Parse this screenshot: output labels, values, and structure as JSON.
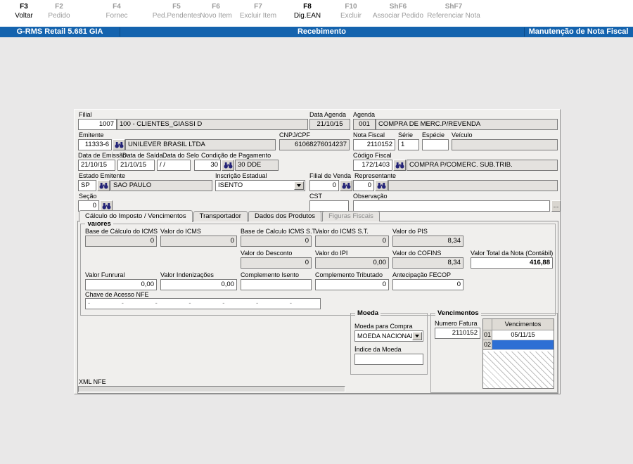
{
  "colors": {
    "titlebar_blue": "#1463ae",
    "selection_blue": "#2e6fd4"
  },
  "fkeys": [
    {
      "key": "F3",
      "label": "Voltar",
      "active": true
    },
    {
      "key": "F2",
      "label": "Pedido",
      "active": false
    },
    {
      "key": "F4",
      "label": "Fornec",
      "active": false
    },
    {
      "key": "F5",
      "label": "Ped.Pendentes",
      "active": false
    },
    {
      "key": "F6",
      "label": "Novo Item",
      "active": false
    },
    {
      "key": "F7",
      "label": "Excluir Item",
      "active": false
    },
    {
      "key": "F8",
      "label": "Dig.EAN",
      "active": true
    },
    {
      "key": "F10",
      "label": "Excluir",
      "active": false
    },
    {
      "key": "ShF6",
      "label": "Associar Pedido",
      "active": false
    },
    {
      "key": "ShF7",
      "label": "Referenciar Nota",
      "active": false
    }
  ],
  "titlebar": {
    "app": "G-RMS Retail 5.681 GIA",
    "screen": "Recebimento",
    "window": "Manutenção de Nota Fiscal"
  },
  "form": {
    "filial": {
      "label": "Filial",
      "code": "1007",
      "name": "100 - CLIENTES_GIASSI D"
    },
    "data_agenda": {
      "label": "Data Agenda",
      "value": "21/10/15"
    },
    "agenda": {
      "label": "Agenda",
      "code": "001",
      "name": "COMPRA DE MERC.P/REVENDA"
    },
    "emitente": {
      "label": "Emitente",
      "code": "11333-6",
      "name": "UNILEVER BRASIL LTDA"
    },
    "cnpj": {
      "label": "CNPJ/CPF",
      "value": "61068276014237"
    },
    "nota_fiscal": {
      "label": "Nota Fiscal",
      "value": "2110152"
    },
    "serie": {
      "label": "Série",
      "value": "1"
    },
    "especie": {
      "label": "Espécie",
      "value": ""
    },
    "veiculo": {
      "label": "Veículo",
      "value": ""
    },
    "data_emissao": {
      "label": "Data de Emissão",
      "value": "21/10/15"
    },
    "data_saida": {
      "label": "Data de Saída",
      "value": "21/10/15"
    },
    "data_selo": {
      "label": "Data do Selo",
      "value": "/ /"
    },
    "cond_pagamento": {
      "label": "Condição de Pagamento",
      "code": "30",
      "name": "30 DDE"
    },
    "codigo_fiscal": {
      "label": "Código Fiscal",
      "code": "172/1403",
      "name": "COMPRA P/COMERC. SUB.TRIB."
    },
    "estado": {
      "label": "Estado Emitente",
      "code": "SP",
      "name": "SAO PAULO"
    },
    "inscricao": {
      "label": "Inscrição Estadual",
      "value": "ISENTO"
    },
    "filial_venda": {
      "label": "Filial de Venda",
      "value": "0"
    },
    "representante": {
      "label": "Representante",
      "code": "0",
      "name": ""
    },
    "secao": {
      "label": "Seção",
      "value": "0"
    },
    "cst": {
      "label": "CST",
      "value": ""
    },
    "observacao": {
      "label": "Observação",
      "value": "",
      "button": "..."
    }
  },
  "tabs": [
    {
      "label": "Cálculo do Imposto / Vencimentos",
      "active": true
    },
    {
      "label": "Transportador",
      "active": false
    },
    {
      "label": "Dados dos Produtos",
      "active": false
    },
    {
      "label": "Figuras Fiscais",
      "active": false,
      "disabled": true
    }
  ],
  "valores": {
    "title": "Valores",
    "row1": [
      {
        "label": "Base de Cálculo do ICMS",
        "value": "0"
      },
      {
        "label": "Valor do ICMS",
        "value": "0"
      },
      {
        "label": "Base de Calculo ICMS S.T.",
        "value": "0"
      },
      {
        "label": "Valor do ICMS S.T.",
        "value": "0"
      },
      {
        "label": "Valor do PIS",
        "value": "8,34"
      }
    ],
    "row2": [
      {
        "label": "Valor do Desconto",
        "value": "0"
      },
      {
        "label": "Valor do IPI",
        "value": "0,00"
      },
      {
        "label": "Valor do COFINS",
        "value": "8,34"
      },
      {
        "label": "Valor Total da Nota (Contábil)",
        "value": "416,88"
      }
    ],
    "row3": [
      {
        "label": "Valor Funrural",
        "value": "0,00"
      },
      {
        "label": "Valor Indenizações",
        "value": "0,00"
      },
      {
        "label": "Complemento Isento",
        "value": ""
      },
      {
        "label": "Complemento Tributado",
        "value": "0"
      },
      {
        "label": "Antecipação FECOP",
        "value": "0"
      }
    ],
    "chave": {
      "label": "Chave de Acesso NFE",
      "value": "- - - - - - -"
    }
  },
  "moeda": {
    "title": "Moeda",
    "compra": {
      "label": "Moeda para Compra",
      "value": "MOEDA NACIONAL"
    },
    "indice": {
      "label": "Índice da Moeda",
      "value": ""
    }
  },
  "vencimentos": {
    "title": "Vencimentos",
    "numero_fatura": {
      "label": "Numero Fatura",
      "value": "2110152"
    },
    "grid_header": "Vencimentos",
    "rows": [
      {
        "num": "01",
        "date": "05/11/15",
        "selected": false
      },
      {
        "num": "02",
        "date": "",
        "selected": true
      }
    ]
  },
  "xml_nfe": {
    "label": "XML NFE"
  }
}
